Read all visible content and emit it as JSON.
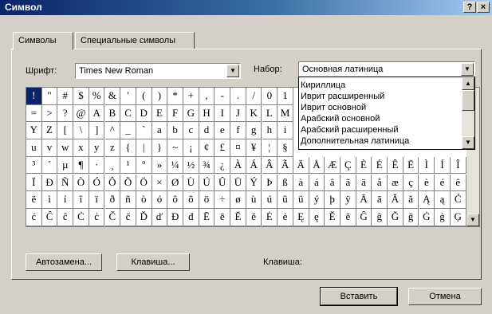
{
  "window": {
    "title": "Символ",
    "help_button": "?",
    "close_button": "×"
  },
  "tabs": [
    {
      "label": "Символы"
    },
    {
      "label": "Специальные символы"
    }
  ],
  "font": {
    "label": "Шрифт:",
    "value": "Times New Roman"
  },
  "subset": {
    "label": "Набор:",
    "value": "Основная латиница",
    "options": [
      "Кириллица",
      "Иврит расширенный",
      "Иврит основной",
      "Арабский основной",
      "Арабский расширенный",
      "Дополнительная латиница"
    ]
  },
  "symbol_grid": {
    "rows": [
      [
        "!",
        "\"",
        "#",
        "$",
        "%",
        "&",
        "'",
        "(",
        ")",
        "*",
        "+",
        ",",
        "-",
        ".",
        "/",
        "0",
        "1"
      ],
      [
        "=",
        ">",
        "?",
        "@",
        "A",
        "B",
        "C",
        "D",
        "E",
        "F",
        "G",
        "H",
        "I",
        "J",
        "K",
        "L",
        "M"
      ],
      [
        "Y",
        "Z",
        "[",
        "\\",
        "]",
        "^",
        "_",
        "`",
        "a",
        "b",
        "c",
        "d",
        "e",
        "f",
        "g",
        "h",
        "i"
      ],
      [
        "u",
        "v",
        "w",
        "x",
        "y",
        "z",
        "{",
        "|",
        "}",
        "~",
        "¡",
        "¢",
        "£",
        "¤",
        "¥",
        "¦",
        "§"
      ],
      [
        "³",
        "´",
        "µ",
        "¶",
        "·",
        "¸",
        "¹",
        "º",
        "»",
        "¼",
        "½",
        "¾",
        "¿",
        "À",
        "Á",
        "Â",
        "Ã",
        "Ä",
        "Å",
        "Æ",
        "Ç",
        "È",
        "É",
        "Ê",
        "Ë",
        "Ì",
        "Í",
        "Î"
      ],
      [
        "Ï",
        "Ð",
        "Ñ",
        "Ò",
        "Ó",
        "Ô",
        "Õ",
        "Ö",
        "×",
        "Ø",
        "Ù",
        "Ú",
        "Û",
        "Ü",
        "Ý",
        "Þ",
        "ß",
        "à",
        "á",
        "â",
        "ã",
        "ä",
        "å",
        "æ",
        "ç",
        "è",
        "é",
        "ê"
      ],
      [
        "ë",
        "ì",
        "í",
        "î",
        "ï",
        "ð",
        "ñ",
        "ò",
        "ó",
        "ô",
        "õ",
        "ö",
        "÷",
        "ø",
        "ù",
        "ú",
        "û",
        "ü",
        "ý",
        "þ",
        "ÿ",
        "Ā",
        "ā",
        "Ă",
        "ă",
        "Ą",
        "ą",
        "Ć"
      ],
      [
        "ć",
        "Ĉ",
        "ĉ",
        "Ċ",
        "ċ",
        "Č",
        "č",
        "Ď",
        "ď",
        "Đ",
        "đ",
        "Ē",
        "ē",
        "Ĕ",
        "ĕ",
        "Ė",
        "ė",
        "Ę",
        "ę",
        "Ě",
        "ě",
        "Ĝ",
        "ĝ",
        "Ğ",
        "ğ",
        "Ġ",
        "ġ",
        "Ģ"
      ]
    ]
  },
  "buttons": {
    "autocorrect": "Автозамена...",
    "shortcut_key": "Клавиша...",
    "insert": "Вставить",
    "cancel": "Отмена"
  },
  "shortcut_label": "Клавиша:",
  "glyphs": {
    "dropdown_arrow": "▼",
    "scroll_up": "▲",
    "scroll_down": "▼"
  }
}
